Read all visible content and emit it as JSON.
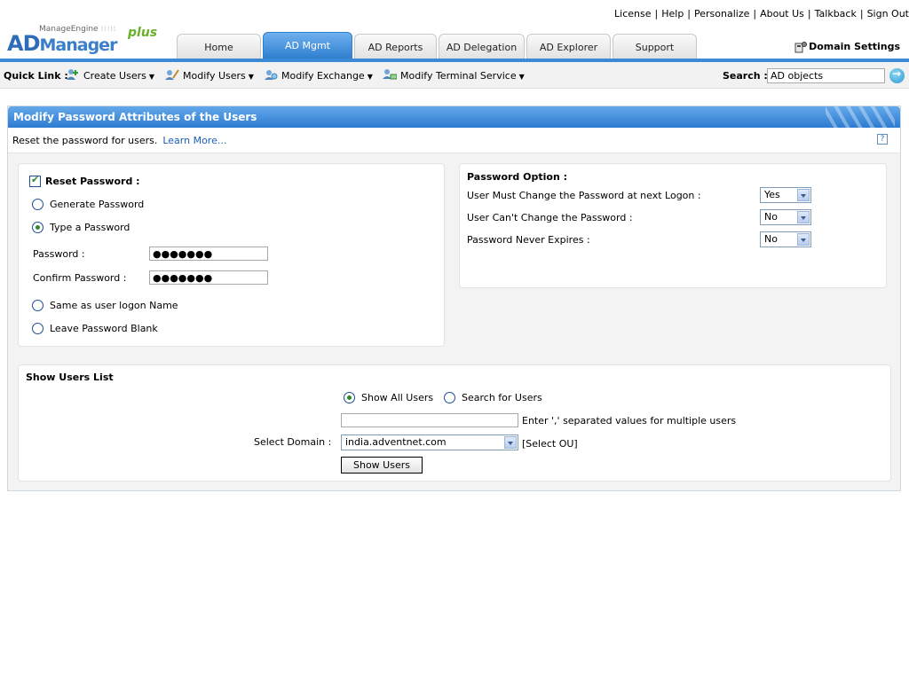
{
  "toplinks": [
    "License",
    "Help",
    "Personalize",
    "About Us",
    "Talkback",
    "Sign Out"
  ],
  "logo": {
    "company": "ManageEngine",
    "product_ad": "AD",
    "product_mgr": "Manager",
    "plus": "plus"
  },
  "tabs": [
    "Home",
    "AD Mgmt",
    "AD Reports",
    "AD Delegation",
    "AD Explorer",
    "Support"
  ],
  "active_tab": "AD Mgmt",
  "domain_settings": "Domain Settings",
  "quicklink": {
    "label": "Quick Link :",
    "items": [
      "Create Users",
      "Modify Users",
      "Modify Exchange",
      "Modify Terminal Service"
    ]
  },
  "search": {
    "label": "Search :",
    "value": "AD objects"
  },
  "panel": {
    "title": "Modify Password Attributes of the Users",
    "description": "Reset the password for users.",
    "learn_more": "Learn More...",
    "help": "?"
  },
  "reset": {
    "checkbox_label": "Reset Password :",
    "checked": true,
    "options": [
      "Generate Password",
      "Type a Password",
      "Same as user logon Name",
      "Leave Password Blank"
    ],
    "selected": "Type a Password",
    "password_label": "Password :",
    "confirm_label": "Confirm Password :",
    "password_value": "●●●●●●●",
    "confirm_value": "●●●●●●●"
  },
  "password_option": {
    "title": "Password Option :",
    "rows": [
      {
        "label": "User Must Change the Password at next Logon :",
        "value": "Yes"
      },
      {
        "label": "User Can't Change the Password :",
        "value": "No"
      },
      {
        "label": "Password Never Expires :",
        "value": "No"
      }
    ]
  },
  "users_list": {
    "title": "Show Users List",
    "show_all": "Show All Users",
    "search_for": "Search for Users",
    "selected": "Show All Users",
    "hint": "Enter ',' separated values for multiple users",
    "domain_label": "Select Domain :",
    "domain_value": "india.adventnet.com",
    "select_ou": "[Select OU]",
    "button": "Show Users"
  },
  "colors": {
    "accent": "#2f7fd0",
    "link": "#1a5fb4",
    "check": "#2b8a2b"
  }
}
